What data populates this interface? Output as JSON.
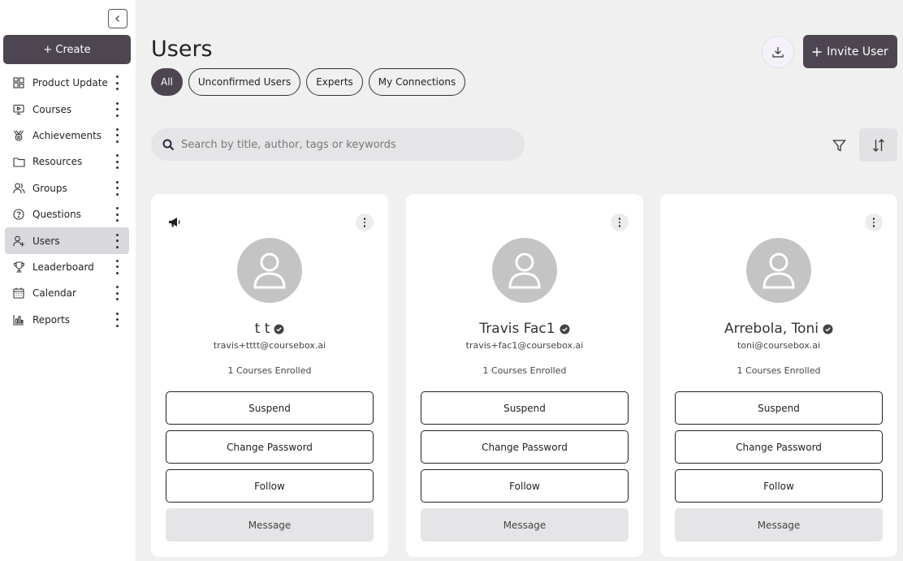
{
  "sidebar": {
    "create_label": "+ Create",
    "items": [
      {
        "label": "Product Update",
        "icon": "dashboard-icon"
      },
      {
        "label": "Courses",
        "icon": "presentation-icon"
      },
      {
        "label": "Achievements",
        "icon": "medal-icon"
      },
      {
        "label": "Resources",
        "icon": "folder-icon"
      },
      {
        "label": "Groups",
        "icon": "users-icon"
      },
      {
        "label": "Questions",
        "icon": "question-icon"
      },
      {
        "label": "Users",
        "icon": "user-plus-icon",
        "active": true
      },
      {
        "label": "Leaderboard",
        "icon": "trophy-icon"
      },
      {
        "label": "Calendar",
        "icon": "calendar-icon"
      },
      {
        "label": "Reports",
        "icon": "bar-chart-icon"
      }
    ]
  },
  "header": {
    "title": "Users",
    "invite_label": "Invite User"
  },
  "filters": [
    "All",
    "Unconfirmed Users",
    "Experts",
    "My Connections"
  ],
  "search": {
    "placeholder": "Search by title, author, tags or keywords"
  },
  "actions": {
    "suspend": "Suspend",
    "change_password": "Change Password",
    "follow": "Follow",
    "message": "Message"
  },
  "users": [
    {
      "name": "t t",
      "email": "travis+tttt@coursebox.ai",
      "courses": "1 Courses Enrolled"
    },
    {
      "name": "Travis Fac1",
      "email": "travis+fac1@coursebox.ai",
      "courses": "1 Courses Enrolled"
    },
    {
      "name": "Arrebola, Toni",
      "email": "toni@coursebox.ai",
      "courses": "1 Courses Enrolled"
    }
  ],
  "colors": {
    "primary": "#4d4650",
    "background": "#f0f0f0",
    "active_nav": "#d9d8dc"
  }
}
